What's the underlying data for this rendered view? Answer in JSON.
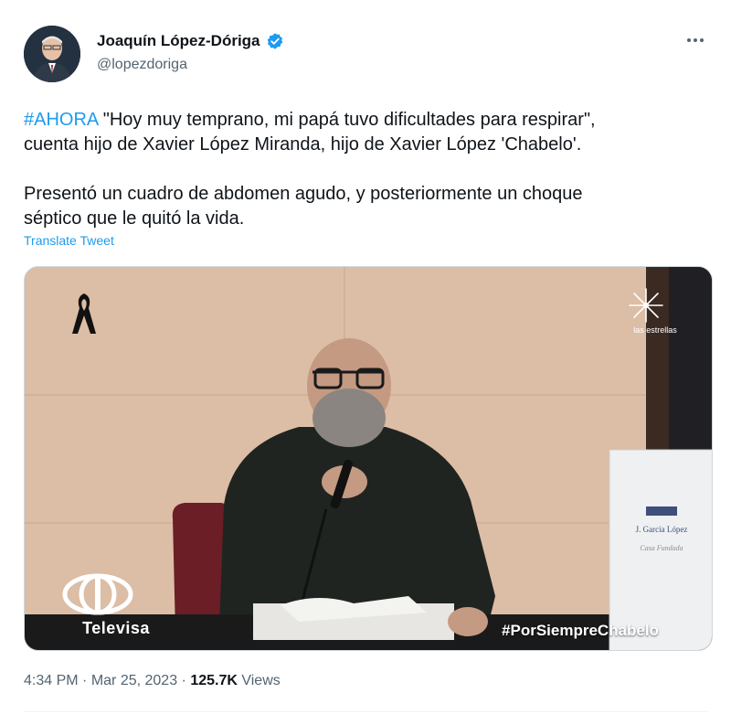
{
  "author": {
    "display_name": "Joaquín López-Dóriga",
    "handle": "@lopezdoriga",
    "verified_icon": "verified-badge-icon",
    "verified_color": "#1d9bf0"
  },
  "tweet": {
    "hashtag": "#AHORA",
    "line1_rest": " \"Hoy muy temprano, mi papá tuvo dificultades para respirar\",",
    "line2": "cuenta hijo de Xavier López Miranda, hijo de Xavier López 'Chabelo'.",
    "para2_line1": "Presentó un cuadro de abdomen agudo, y posteriormente un choque",
    "para2_line2": "séptico que le quitó la vida.",
    "translate_label": "Translate Tweet"
  },
  "media": {
    "network_logo_text": "las estrellas",
    "broadcaster_text": "Televisa",
    "hashtag_overlay": "#PorSiempreChabelo",
    "sign_brand": "J. García López",
    "sign_sub": "Casa Fundada"
  },
  "meta": {
    "time": "4:34 PM",
    "separator": " · ",
    "date": "Mar 25, 2023",
    "views_count": "125.7K",
    "views_label": " Views"
  },
  "colors": {
    "link": "#1d9bf0",
    "secondary_text": "#536471",
    "primary_text": "#0f1419"
  }
}
